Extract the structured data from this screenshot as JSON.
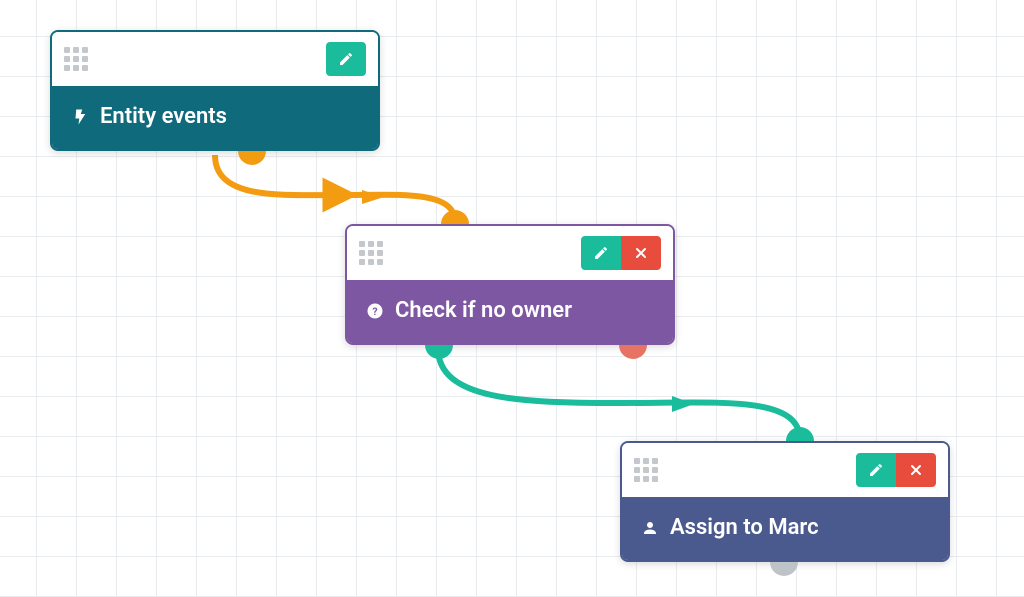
{
  "colors": {
    "edge_orange": "#f39c12",
    "edge_teal": "#1abc9c",
    "port_gray": "#bdc3c7",
    "port_red": "#e67363",
    "node1": "#0f6b7b",
    "node2": "#7e57a3",
    "node3": "#4b5a8e",
    "btn_edit": "#1abc9c",
    "btn_delete": "#e74c3c"
  },
  "nodes": {
    "n1": {
      "title": "Entity events",
      "icon": "bolt",
      "has_delete": false
    },
    "n2": {
      "title": "Check if no owner",
      "icon": "question",
      "has_delete": true
    },
    "n3": {
      "title": "Assign to Marc",
      "icon": "user",
      "has_delete": true
    }
  },
  "edges": [
    {
      "from": "n1",
      "to": "n2",
      "color": "edge_orange"
    },
    {
      "from": "n2",
      "to": "n3",
      "color": "edge_teal"
    }
  ]
}
